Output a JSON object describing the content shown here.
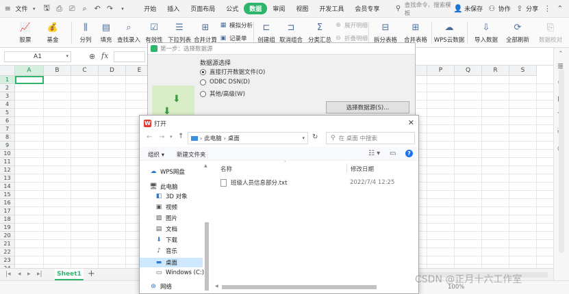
{
  "menubar": {
    "file_label": "文件",
    "tabs": [
      "开始",
      "插入",
      "页面布局",
      "公式",
      "数据",
      "审阅",
      "视图",
      "开发工具",
      "会员专享"
    ],
    "active_tab": "数据",
    "search_placeholder": "查找命令、搜索模板",
    "unsaved_label": "未保存",
    "collab_label": "协作",
    "share_label": "分享"
  },
  "ribbon": {
    "stock": "股票",
    "fund": "基金",
    "split_col": "分列",
    "fill": "填充",
    "find_enter": "查找录入",
    "validity": "有效性",
    "dropdown_list": "下拉列表",
    "merge_calc": "合并计算",
    "sim_analysis": "模拟分析",
    "record_form": "记录单",
    "create_group": "创建组",
    "ungroup": "取消组合",
    "subtotal": "分类汇总",
    "expand_detail": "展开明细",
    "collapse_detail": "折叠明细",
    "split_table": "拆分表格",
    "merge_table": "合并表格",
    "wps_cloud": "WPS云数据",
    "import_data": "导入数据",
    "refresh_all": "全部刷新",
    "data_check": "数据校对"
  },
  "formulabar": {
    "cell_ref": "A1",
    "fx": "fx"
  },
  "grid": {
    "columns": [
      "A",
      "B",
      "C",
      "D",
      "E",
      "F",
      "G",
      "H",
      "I",
      "J",
      "K",
      "L",
      "M",
      "N",
      "O",
      "P",
      "Q",
      "R",
      "S"
    ],
    "rows": [
      "1",
      "2",
      "3",
      "4",
      "5",
      "6",
      "7",
      "8",
      "9",
      "10",
      "11",
      "12",
      "13",
      "14",
      "15",
      "16",
      "17",
      "18",
      "19",
      "20",
      "21",
      "22",
      "23",
      "24"
    ]
  },
  "sheets": {
    "active": "Sheet1",
    "add": "+"
  },
  "wizard": {
    "title": "第一步：选择数据源",
    "group_label": "数据源选择",
    "options": [
      "直接打开数据文件(O)",
      "ODBC DSN(D)",
      "其他/高级(W)"
    ],
    "selected_index": 0,
    "choose_button": "选择数据源(S)..."
  },
  "open_dialog": {
    "title": "打开",
    "path": [
      "此电脑",
      "桌面"
    ],
    "search_placeholder": "在 桌面 中搜索",
    "organize": "组织",
    "new_folder": "新建文件夹",
    "nav": [
      {
        "label": "WPS网盘",
        "icon": "cloud-icon",
        "level": 0
      },
      {
        "label": "此电脑",
        "icon": "computer-icon",
        "level": 0
      },
      {
        "label": "3D 对象",
        "icon": "cube-icon",
        "level": 1
      },
      {
        "label": "视频",
        "icon": "video-icon",
        "level": 1
      },
      {
        "label": "图片",
        "icon": "image-icon",
        "level": 1
      },
      {
        "label": "文档",
        "icon": "document-icon",
        "level": 1
      },
      {
        "label": "下载",
        "icon": "download-icon",
        "level": 1
      },
      {
        "label": "音乐",
        "icon": "music-icon",
        "level": 1
      },
      {
        "label": "桌面",
        "icon": "desktop-icon",
        "level": 1,
        "selected": true
      },
      {
        "label": "Windows (C:)",
        "icon": "drive-icon",
        "level": 1
      },
      {
        "label": "网络",
        "icon": "network-icon",
        "level": 0
      }
    ],
    "col_name": "名称",
    "col_modified": "修改日期",
    "files": [
      {
        "name": "班级人员信息部分.txt",
        "modified": "2022/7/4 12:25"
      }
    ]
  },
  "status": {
    "zoom": "100%"
  },
  "watermark": "CSDN @正月十六工作室",
  "colors": {
    "accent": "#2fb56b",
    "selection": "#cde8ff"
  }
}
